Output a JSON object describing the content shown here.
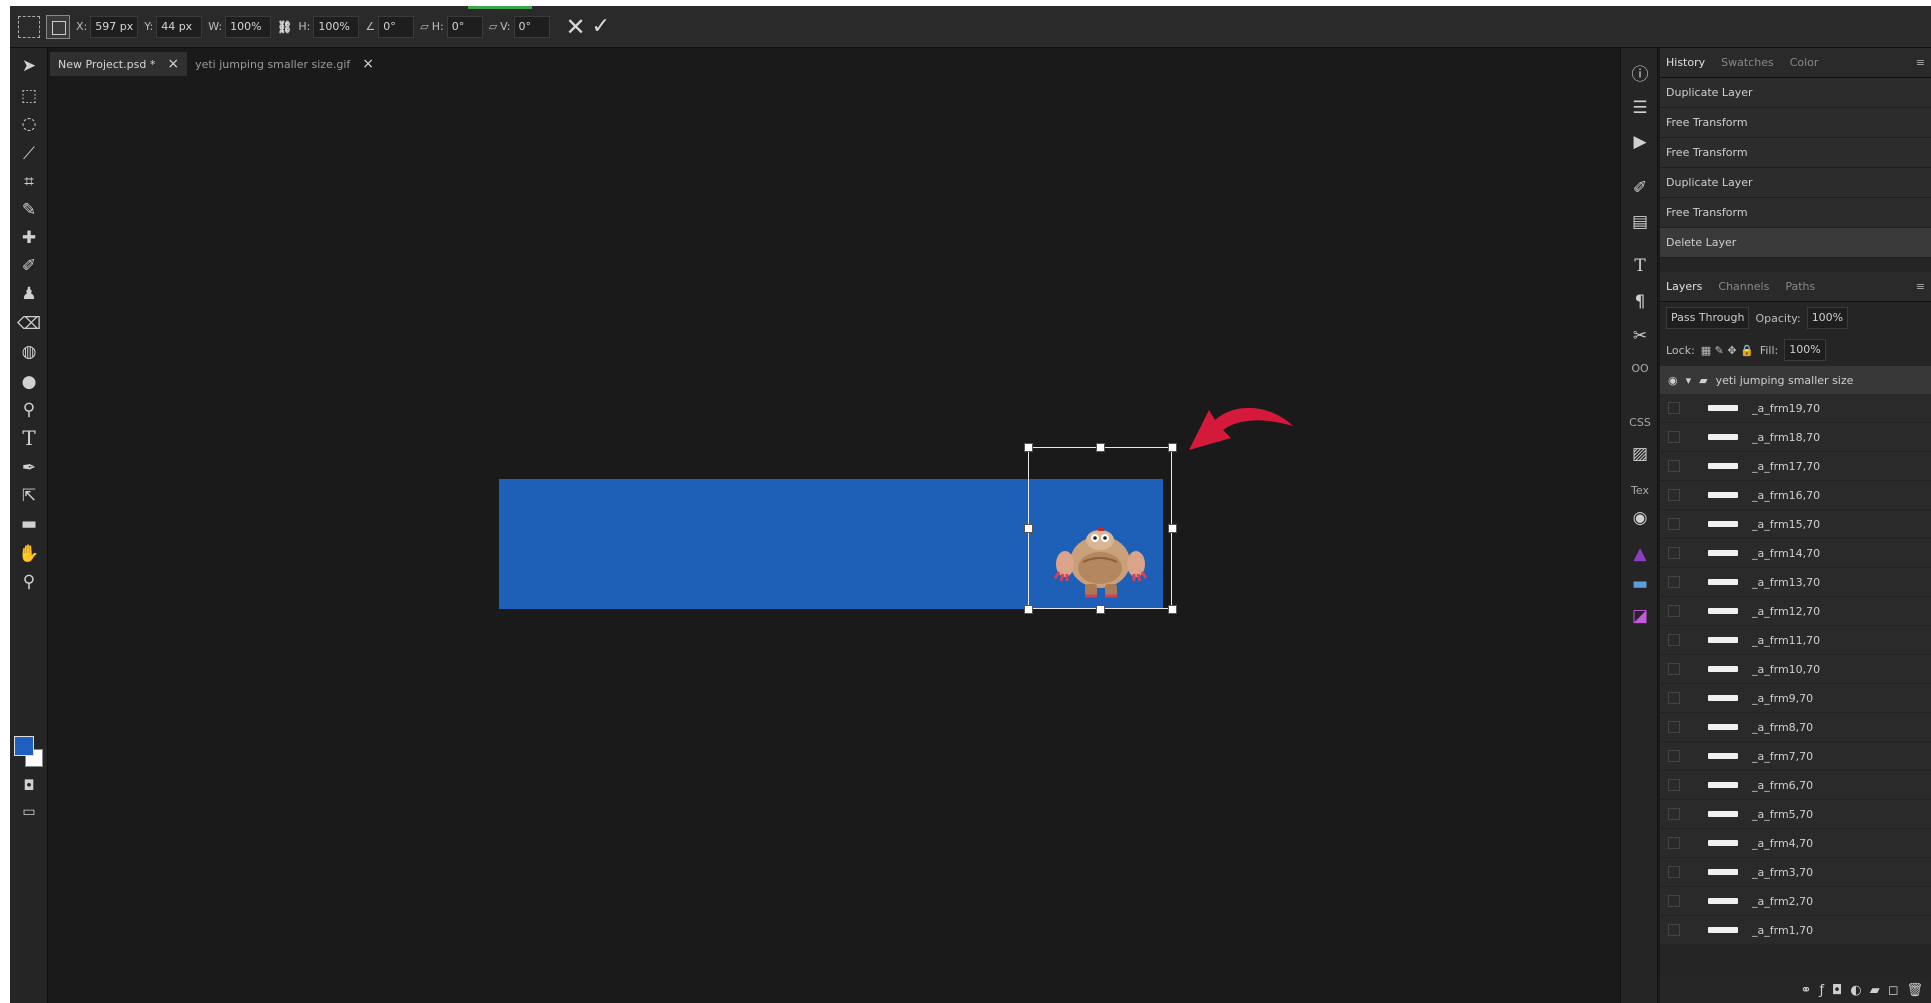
{
  "options_bar": {
    "x_label": "X:",
    "x_value": "597 px",
    "y_label": "Y:",
    "y_value": "44 px",
    "w_label": "W:",
    "w_value": "100%",
    "h_label": "H:",
    "h_value": "100%",
    "angle_value": "0°",
    "skew_h_label": "H:",
    "skew_h_value": "0°",
    "skew_v_label": "V:",
    "skew_v_value": "0°"
  },
  "doc_tabs": [
    {
      "label": "New Project.psd *",
      "active": true
    },
    {
      "label": "yeti jumping smaller size.gif",
      "active": false
    }
  ],
  "colors": {
    "foreground": "#1e5fbf",
    "background": "#ffffff",
    "canvas_doc": "#1e5fb8",
    "arrow": "#d4193a"
  },
  "history_panel": {
    "tabs": [
      "History",
      "Swatches",
      "Color"
    ],
    "items": [
      "Duplicate Layer",
      "Free Transform",
      "Free Transform",
      "Duplicate Layer",
      "Free Transform",
      "Delete Layer"
    ]
  },
  "layers_panel": {
    "tabs": [
      "Layers",
      "Channels",
      "Paths"
    ],
    "blend_mode": "Pass Through",
    "opacity_label": "Opacity:",
    "opacity_value": "100%",
    "lock_label": "Lock:",
    "fill_label": "Fill:",
    "fill_value": "100%",
    "group_name": "yeti jumping smaller size",
    "layers": [
      "_a_frm19,70",
      "_a_frm18,70",
      "_a_frm17,70",
      "_a_frm16,70",
      "_a_frm15,70",
      "_a_frm14,70",
      "_a_frm13,70",
      "_a_frm12,70",
      "_a_frm11,70",
      "_a_frm10,70",
      "_a_frm9,70",
      "_a_frm8,70",
      "_a_frm7,70",
      "_a_frm6,70",
      "_a_frm5,70",
      "_a_frm4,70",
      "_a_frm3,70",
      "_a_frm2,70",
      "_a_frm1,70"
    ]
  },
  "right_icons": [
    "info-icon",
    "list-icon",
    "play-icon",
    "brush-settings-icon",
    "clone-source-icon",
    "character-icon",
    "paragraph-icon",
    "tools-icon",
    "link-icon"
  ],
  "right_text_icons": {
    "oo": "OO",
    "css": "CSS",
    "tex": "Tex"
  }
}
